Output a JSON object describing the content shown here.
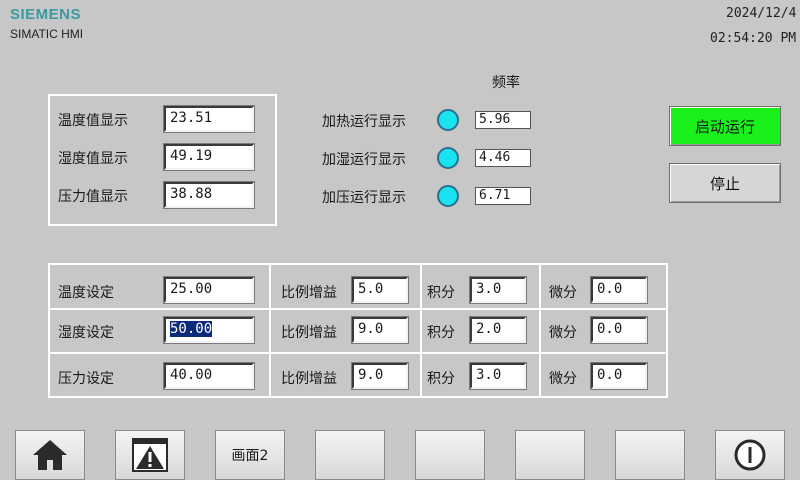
{
  "header": {
    "brand": "SIEMENS",
    "product": "SIMATIC HMI",
    "date": "2024/12/4",
    "time": "02:54:20 PM"
  },
  "frequency_label": "频率",
  "display_panel": {
    "rows": [
      {
        "label": "温度值显示",
        "value": "23.51"
      },
      {
        "label": "湿度值显示",
        "value": "49.19"
      },
      {
        "label": "压力值显示",
        "value": "38.88"
      }
    ]
  },
  "run_panel": {
    "lamp_color": "#18e3ee",
    "rows": [
      {
        "label": "加热运行显示",
        "frequency": "5.96"
      },
      {
        "label": "加湿运行显示",
        "frequency": "4.46"
      },
      {
        "label": "加压运行显示",
        "frequency": "6.71"
      }
    ]
  },
  "buttons": {
    "start": "启动运行",
    "stop": "停止",
    "start_color": "#1af01a"
  },
  "settings_table": {
    "rows": [
      {
        "label": "温度设定",
        "setpoint": "25.00",
        "gain_label": "比例增益",
        "gain": "5.0",
        "integral_label": "积分",
        "integral": "3.0",
        "derivative_label": "微分",
        "derivative": "0.0"
      },
      {
        "label": "湿度设定",
        "setpoint": "50.00",
        "gain_label": "比例增益",
        "gain": "9.0",
        "integral_label": "积分",
        "integral": "2.0",
        "derivative_label": "微分",
        "derivative": "0.0"
      },
      {
        "label": "压力设定",
        "setpoint": "40.00",
        "gain_label": "比例增益",
        "gain": "9.0",
        "integral_label": "积分",
        "integral": "3.0",
        "derivative_label": "微分",
        "derivative": "0.0"
      }
    ]
  },
  "function_keys": [
    {
      "icon": "home-icon",
      "label": ""
    },
    {
      "icon": "alarm-warning-icon",
      "label": ""
    },
    {
      "icon": "",
      "label": "画面2"
    },
    {
      "icon": "",
      "label": ""
    },
    {
      "icon": "",
      "label": ""
    },
    {
      "icon": "",
      "label": ""
    },
    {
      "icon": "",
      "label": ""
    },
    {
      "icon": "power-icon",
      "label": ""
    }
  ]
}
